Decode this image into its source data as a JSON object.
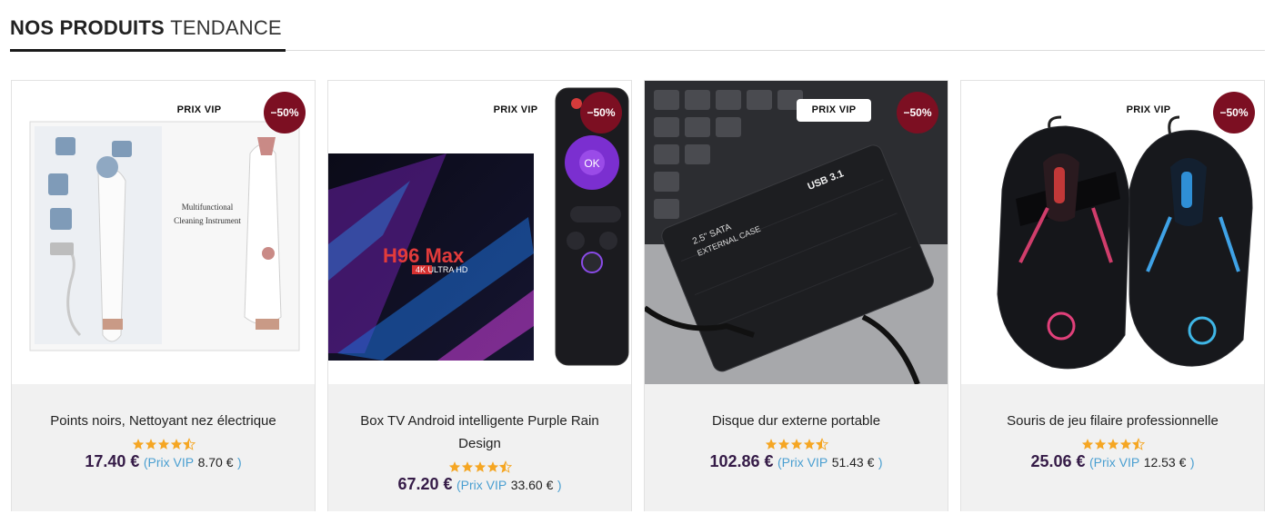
{
  "section": {
    "title_bold": "NOS PRODUITS",
    "title_light": "TENDANCE"
  },
  "products": [
    {
      "name": "Points noirs, Nettoyant nez électrique",
      "vip_tag": "PRIX VIP",
      "discount": "−50%",
      "rating": 4.5,
      "price": "17.40 €",
      "vip_open": "(",
      "vip_label": "Prix VIP",
      "vip_price": "8.70 €",
      "vip_close": ")",
      "image_icon": "blackhead-vacuum-icon",
      "image_text_1": "Multifunctional",
      "image_text_2": "Cleaning Instrument"
    },
    {
      "name": "Box TV Android intelligente Purple Rain Design",
      "vip_tag": "PRIX VIP",
      "discount": "−50%",
      "rating": 4.5,
      "price": "67.20 €",
      "vip_open": "(",
      "vip_label": "Prix VIP",
      "vip_price": "33.60 €",
      "vip_close": ")",
      "image_icon": "tv-box-remote-icon",
      "image_brand": "H96 Max",
      "image_sub": "4K ULTRA HD",
      "remote_ok": "OK"
    },
    {
      "name": "Disque dur externe portable",
      "vip_tag": "PRIX VIP",
      "discount": "−50%",
      "rating": 4.5,
      "price": "102.86 €",
      "vip_open": "(",
      "vip_label": "Prix VIP",
      "vip_price": "51.43 €",
      "vip_close": ")",
      "image_icon": "external-hard-drive-icon",
      "image_text_1": "2.5\" SATA",
      "image_text_2": "EXTERNAL CASE",
      "image_text_3": "USB 3.1"
    },
    {
      "name": "Souris de jeu filaire professionnelle",
      "vip_tag": "PRIX VIP",
      "discount": "−50%",
      "rating": 4.5,
      "price": "25.06 €",
      "vip_open": "(",
      "vip_label": "Prix VIP",
      "vip_price": "12.53 €",
      "vip_close": ")",
      "image_icon": "gaming-mouse-icon"
    }
  ],
  "colors": {
    "discount_badge": "#7c0f22",
    "price": "#351b47",
    "vip_link": "#4a9fd1",
    "star": "#f5a623",
    "info_bg": "#f1f1f1"
  }
}
